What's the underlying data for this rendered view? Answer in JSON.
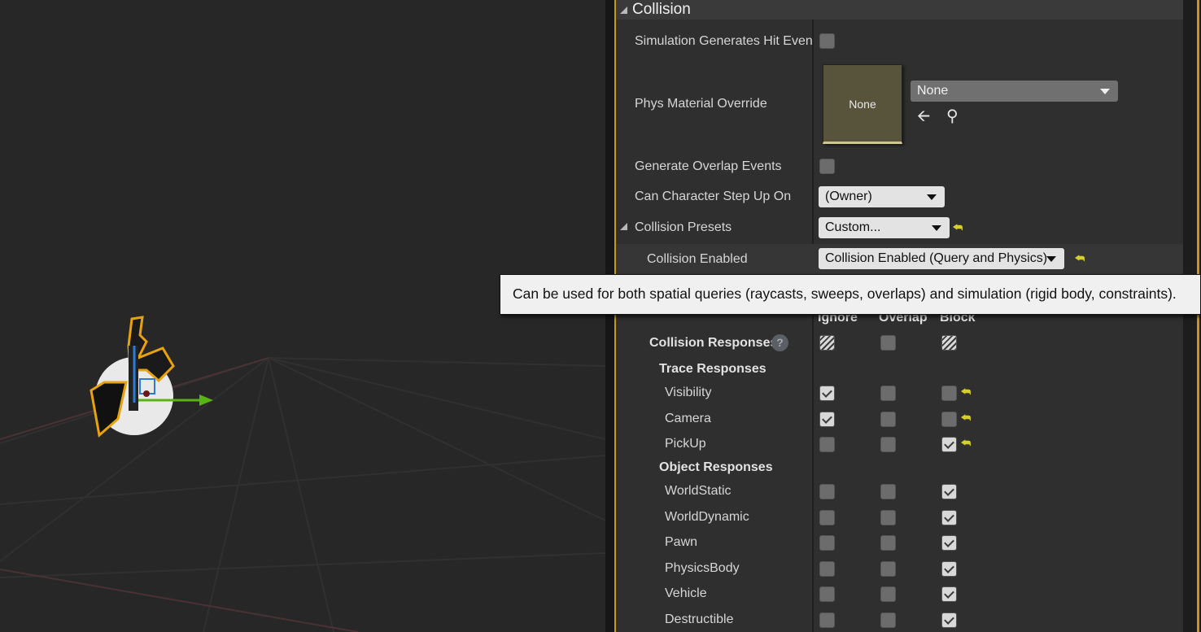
{
  "section": {
    "title": "Collision"
  },
  "properties": {
    "sim_hit_events": {
      "label": "Simulation Generates Hit Event",
      "checked": false
    },
    "phys_material": {
      "label": "Phys Material Override",
      "thumb_text": "None",
      "dropdown_value": "None"
    },
    "overlap_events": {
      "label": "Generate Overlap Events",
      "checked": false
    },
    "step_up": {
      "label": "Can Character Step Up On",
      "value": "(Owner)"
    },
    "presets": {
      "label": "Collision Presets",
      "value": "Custom..."
    },
    "collision_enabled": {
      "label": "Collision Enabled",
      "value": "Collision Enabled (Query and Physics)"
    }
  },
  "tooltip": {
    "text": "Can be used for both spatial queries (raycasts, sweeps, overlaps) and simulation (rigid body, constraints)."
  },
  "responses": {
    "columns": [
      "Ignore",
      "Overlap",
      "Block"
    ],
    "header_label": "Collision Responses",
    "help_icon": "?",
    "trace_label": "Trace Responses",
    "object_label": "Object Responses",
    "trace_rows": [
      {
        "label": "Visibility",
        "ignore": true,
        "overlap": false,
        "block": false,
        "reset": true
      },
      {
        "label": "Camera",
        "ignore": true,
        "overlap": false,
        "block": false,
        "reset": true
      },
      {
        "label": "PickUp",
        "ignore": false,
        "overlap": false,
        "block": true,
        "reset": true
      }
    ],
    "object_rows": [
      {
        "label": "WorldStatic",
        "ignore": false,
        "overlap": false,
        "block": true
      },
      {
        "label": "WorldDynamic",
        "ignore": false,
        "overlap": false,
        "block": true
      },
      {
        "label": "Pawn",
        "ignore": false,
        "overlap": false,
        "block": true
      },
      {
        "label": "PhysicsBody",
        "ignore": false,
        "overlap": false,
        "block": true
      },
      {
        "label": "Vehicle",
        "ignore": false,
        "overlap": false,
        "block": true
      },
      {
        "label": "Destructible",
        "ignore": false,
        "overlap": false,
        "block": true
      }
    ]
  },
  "icons": {
    "reset": "reset-to-default-icon",
    "browse": "search-icon",
    "use": "arrow-left-icon"
  },
  "colors": {
    "accent": "#c59a1a",
    "reset": "#d8d02a"
  }
}
